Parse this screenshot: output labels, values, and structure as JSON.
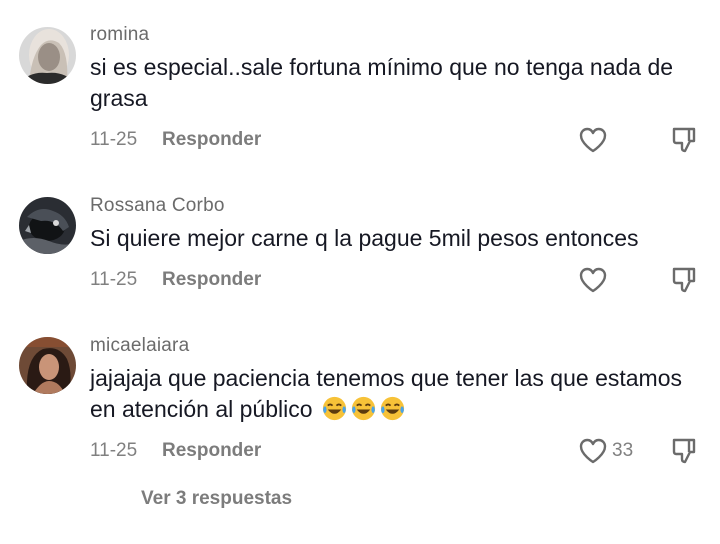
{
  "comments": [
    {
      "username": "romina",
      "text": "si es especial..sale fortuna mínimo que no tenga nada de grasa",
      "date": "11-25",
      "reply_label": "Responder",
      "like_count": ""
    },
    {
      "username": "Rossana Corbo",
      "text": "Si quiere mejor carne q la pague 5mil pesos entonces",
      "date": "11-25",
      "reply_label": "Responder",
      "like_count": ""
    },
    {
      "username": "micaelaiara",
      "text": "jajajaja que paciencia tenemos que tener las que estamos en atención al público",
      "emojis": "😂😂😂",
      "date": "11-25",
      "reply_label": "Responder",
      "like_count": "33"
    }
  ],
  "view_replies_label": "Ver 3 respuestas",
  "colors": {
    "text": "#161823",
    "muted": "#808080",
    "icon": "#6b6b6b"
  },
  "icons": [
    "heart-outline-icon",
    "thumbs-down-icon",
    "tears-of-joy-emoji"
  ]
}
